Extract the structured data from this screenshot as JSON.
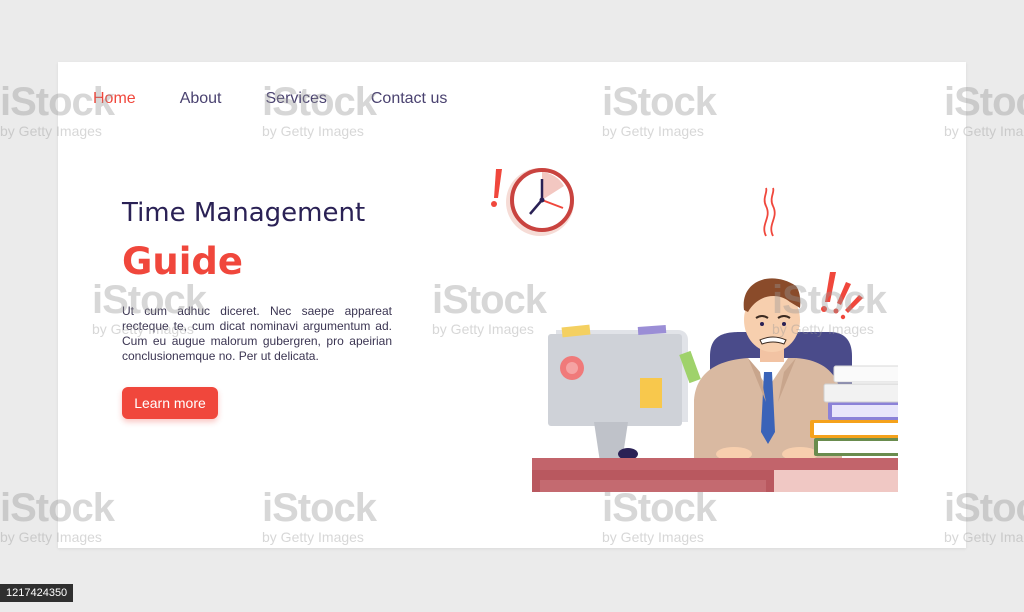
{
  "nav": {
    "items": [
      {
        "label": "Home",
        "active": true
      },
      {
        "label": "About",
        "active": false
      },
      {
        "label": "Services",
        "active": false
      },
      {
        "label": "Contact us",
        "active": false
      }
    ]
  },
  "hero": {
    "title": "Time Management",
    "subtitle": "Guide",
    "body": "Ut cum adhuc diceret. Nec saepe appareat recteque te, cum dicat nominavi argumentum ad. Cum eu augue malorum gubergren, pro apeirian conclusionemque no. Per ut delicata.",
    "cta_label": "Learn more"
  },
  "watermark": {
    "brand": "iStock",
    "credit": "by Getty Images"
  },
  "stock_id": "1217424350",
  "colors": {
    "accent": "#f0473c",
    "heading": "#2a2155",
    "nav": "#4a4270",
    "background": "#ebebeb",
    "card": "#ffffff"
  },
  "illustration": {
    "icons": [
      "clock-icon",
      "exclamation-icon",
      "computer-monitor-icon",
      "office-worker-figure",
      "binder-stack-icon",
      "desk-icon"
    ]
  }
}
